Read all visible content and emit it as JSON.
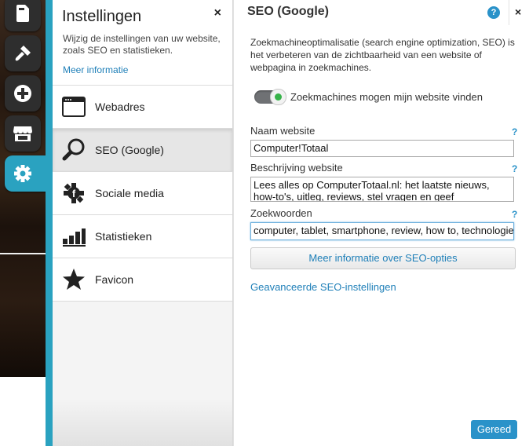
{
  "rail": {
    "items": [
      {
        "name": "page-icon"
      },
      {
        "name": "paint-brush-icon"
      },
      {
        "name": "add-icon"
      },
      {
        "name": "store-icon"
      },
      {
        "name": "gear-icon"
      }
    ]
  },
  "settings": {
    "title": "Instellingen",
    "close": "×",
    "description": "Wijzig de instellingen van uw website, zoals SEO en statistieken.",
    "more_info": "Meer informatie",
    "menu": [
      {
        "label": "Webadres",
        "icon": "browser-window-icon"
      },
      {
        "label": "SEO (Google)",
        "icon": "magnifier-icon",
        "active": true
      },
      {
        "label": "Sociale media",
        "icon": "social-icon"
      },
      {
        "label": "Statistieken",
        "icon": "bar-chart-icon"
      },
      {
        "label": "Favicon",
        "icon": "star-icon"
      }
    ]
  },
  "seo": {
    "title": "SEO (Google)",
    "help": "?",
    "close": "×",
    "description": "Zoekmachineoptimalisatie (search engine optimization, SEO) is het verbeteren van de zichtbaarheid van een website of webpagina in zoekmachines.",
    "toggle_label": "Zoekmachines mogen mijn website vinden",
    "toggle_on": true,
    "site_name_label": "Naam website",
    "site_name_value": "Computer!Totaal",
    "site_desc_label": "Beschrijving website",
    "site_desc_value": "Lees alles op ComputerTotaal.nl: het laatste nieuws, how-to's, uitleg, reviews, stel vragen en geef antwoorden.",
    "keywords_label": "Zoekwoorden",
    "keywords_value": "computer, tablet, smartphone, review, how to, technologie",
    "field_help": "?",
    "more_button": "Meer informatie over SEO-opties",
    "advanced_link": "Geavanceerde SEO-instellingen",
    "done_button": "Gereed"
  },
  "colors": {
    "accent": "#2aa2c0",
    "link": "#1e7fb8",
    "button": "#2a92c9",
    "toggle_on": "#37b34a"
  }
}
